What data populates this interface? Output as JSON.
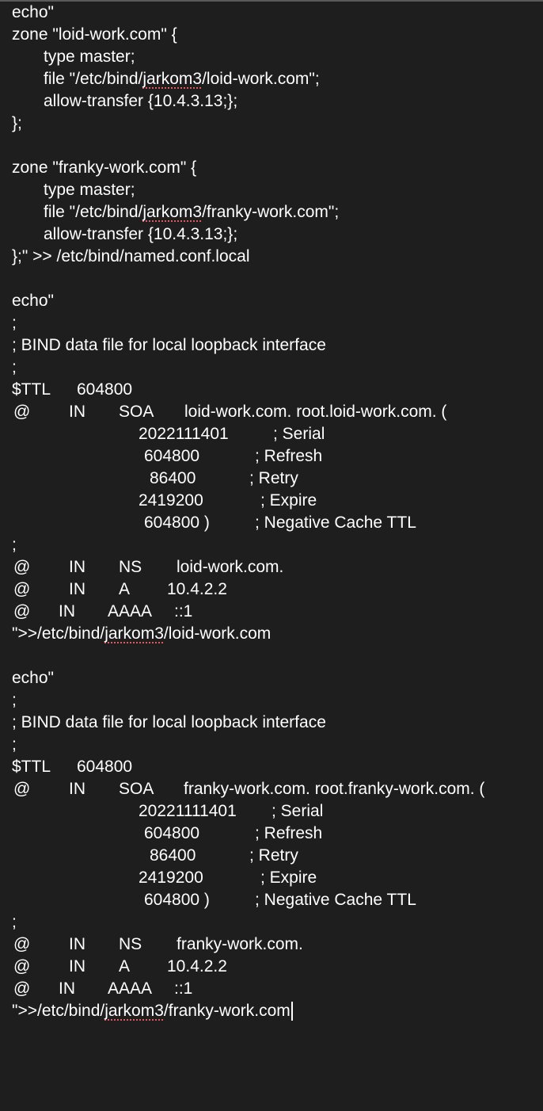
{
  "editor": {
    "l1": "echo\"",
    "l2": "zone \"loid-work.com\" {",
    "l3": "type master;",
    "l4_pre": "file \"/etc/bind/",
    "l4_word": "jarkom3",
    "l4_post": "/loid-work.com\";",
    "l5": "allow-transfer {10.4.3.13;};",
    "l6": "};",
    "l8": "zone \"franky-work.com\" {",
    "l9": "type master;",
    "l10_pre": "file \"/etc/bind/",
    "l10_word": "jarkom3",
    "l10_post": "/franky-work.com\";",
    "l11": "allow-transfer {10.4.3.13;};",
    "l12": "};\" >> /etc/bind/named.conf.local",
    "l14": "echo\"",
    "l15": ";",
    "l16": "; BIND data file for local loopback interface",
    "l17": ";",
    "l18a": "$TTL",
    "l18b": "604800",
    "l19a": "@",
    "l19b": "IN",
    "l19c": "SOA",
    "l19d": "loid-work.com. root.loid-work.com. (",
    "l20a": "2022111401",
    "l20b": "; Serial",
    "l21a": "604800",
    "l21b": "; Refresh",
    "l22a": "86400",
    "l22b": "; Retry",
    "l23a": "2419200",
    "l23b": "; Expire",
    "l24a": "604800 )",
    "l24b": "; Negative Cache TTL",
    "l25": ";",
    "l26a": "@",
    "l26b": "IN",
    "l26c": "NS",
    "l26d": "loid-work.com.",
    "l27a": "@",
    "l27b": "IN",
    "l27c": "A",
    "l27d": "10.4.2.2",
    "l28a": "@",
    "l28b": "IN",
    "l28c": "AAAA",
    "l28d": "::1",
    "l29_pre": "\">>/etc/bind/",
    "l29_word": "jarkom3",
    "l29_post": "/loid-work.com",
    "l31": "echo\"",
    "l32": ";",
    "l33": "; BIND data file for local loopback interface",
    "l34": ";",
    "l35a": "$TTL",
    "l35b": "604800",
    "l36a": "@",
    "l36b": "IN",
    "l36c": "SOA",
    "l36d": "franky-work.com. root.franky-work.com. (",
    "l37a": "20221111401",
    "l37b": "; Serial",
    "l38a": "604800",
    "l38b": "; Refresh",
    "l39a": "86400",
    "l39b": "; Retry",
    "l40a": "2419200",
    "l40b": "; Expire",
    "l41a": "604800 )",
    "l41b": "; Negative Cache TTL",
    "l42": ";",
    "l43a": "@",
    "l43b": "IN",
    "l43c": "NS",
    "l43d": "franky-work.com.",
    "l44a": "@",
    "l44b": "IN",
    "l44c": "A",
    "l44d": "10.4.2.2",
    "l45a": "@",
    "l45b": "IN",
    "l45c": "AAAA",
    "l45d": "::1",
    "l46_pre": "\">>/etc/bind/",
    "l46_word": "jarkom3",
    "l46_post": "/franky-work.com"
  },
  "theme": {
    "background": "#1e1e1e",
    "text": "#ffffff",
    "spellcheck_underline": "#e0585b"
  }
}
